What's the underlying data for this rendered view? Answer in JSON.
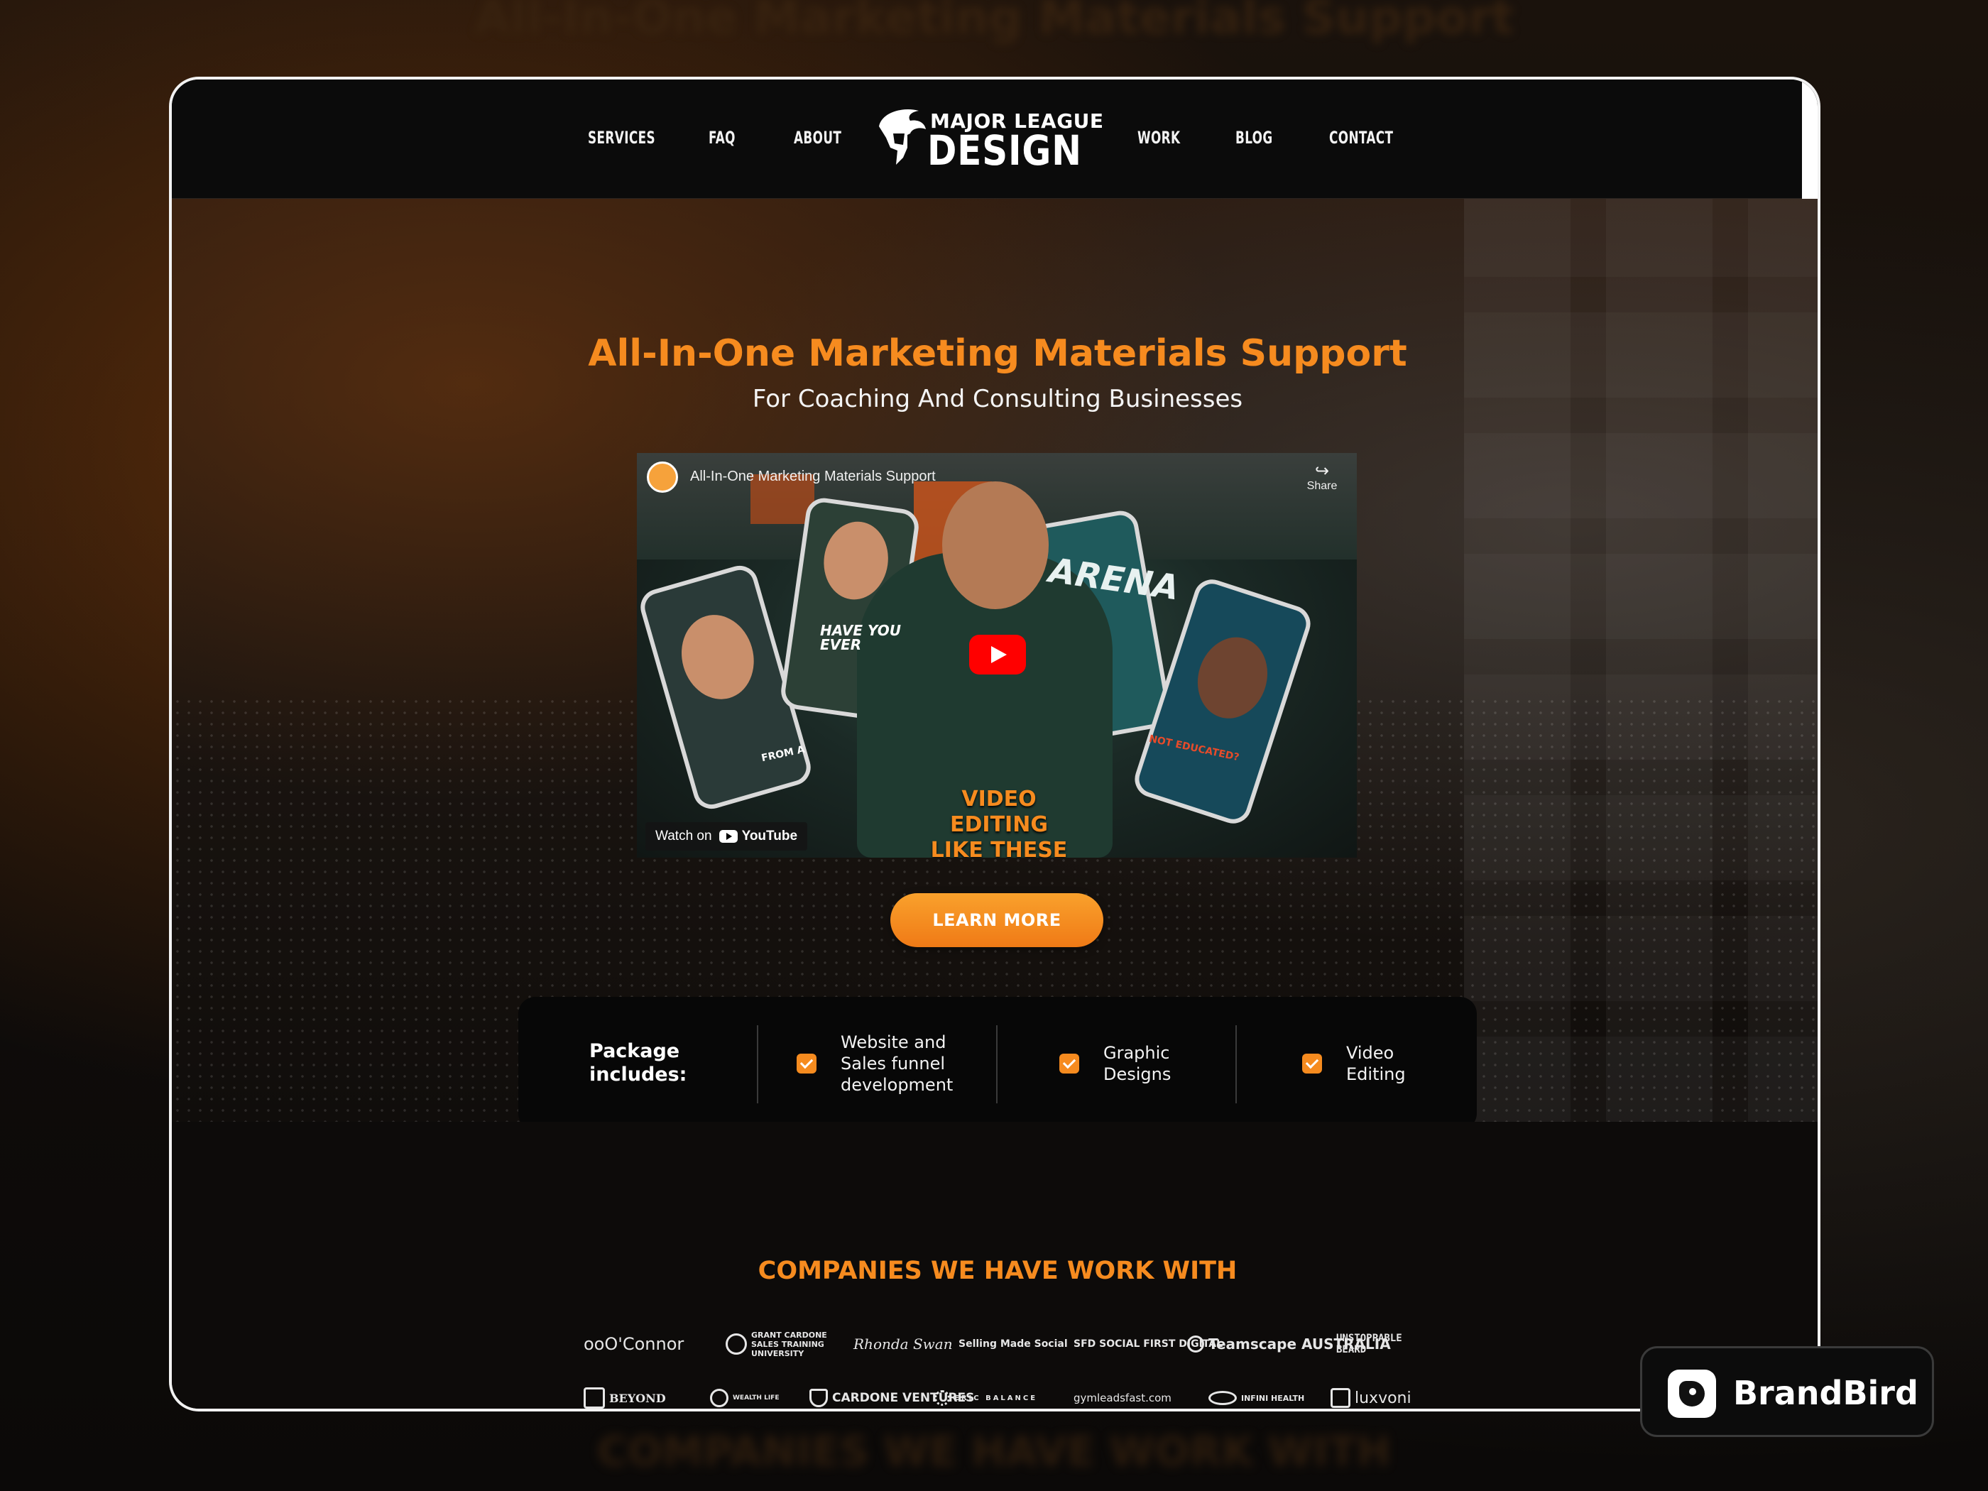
{
  "nav": {
    "items_left": [
      "SERVICES",
      "FAQ",
      "ABOUT"
    ],
    "items_right": [
      "WORK",
      "BLOG",
      "CONTACT"
    ],
    "logo_top": "MAJOR LEAGUE",
    "logo_bottom": "DESIGN"
  },
  "hero": {
    "title": "All-In-One Marketing Materials Support",
    "subtitle": "For Coaching And Consulting Businesses",
    "cta_label": "LEARN MORE"
  },
  "video": {
    "title": "All-In-One Marketing Materials Support",
    "share_label": "Share",
    "watch_on_label": "Watch on",
    "platform_label": "YouTube",
    "caption_line1": "VIDEO EDITING",
    "caption_line2": "LIKE THESE",
    "overlay_have": "HAVE YOU",
    "overlay_ever": "EVER",
    "overlay_arena": "ARENA",
    "overlay_from": "FROM A",
    "overlay_not": "NOT EDUCATED?"
  },
  "package": {
    "label": "Package includes:",
    "items": [
      {
        "label": "Website and Sales funnel development"
      },
      {
        "label": "Graphic Designs"
      },
      {
        "label": "Video Editing"
      }
    ]
  },
  "companies": {
    "title": "COMPANIES WE HAVE WORK WITH",
    "row1": [
      "ooO'Connor",
      "GRANT CARDONE SALES TRAINING UNIVERSITY",
      "Rhonda Swan",
      "Selling Made Social",
      "SFD SOCIAL FIRST DIGITAL",
      "Teamscape AUSTRALIA",
      "UNSTOPPABLE BEARD"
    ],
    "row2": [
      "BEYOND",
      "WEALTH LIFE",
      "CARDONE VENTURES",
      "ERIC BALANCE",
      "gymleadsfast.com",
      "INFINI HEALTH",
      "luxvoni"
    ]
  },
  "badge": {
    "label": "BrandBird"
  },
  "backdrop": {
    "ghost_top": "All-In-One Marketing Materials Support",
    "ghost_bottom": "COMPANIES WE HAVE WORK WITH"
  },
  "colors": {
    "accent": "#f68b1f",
    "youtube_red": "#ff0000",
    "background": "#0d0b0a"
  }
}
